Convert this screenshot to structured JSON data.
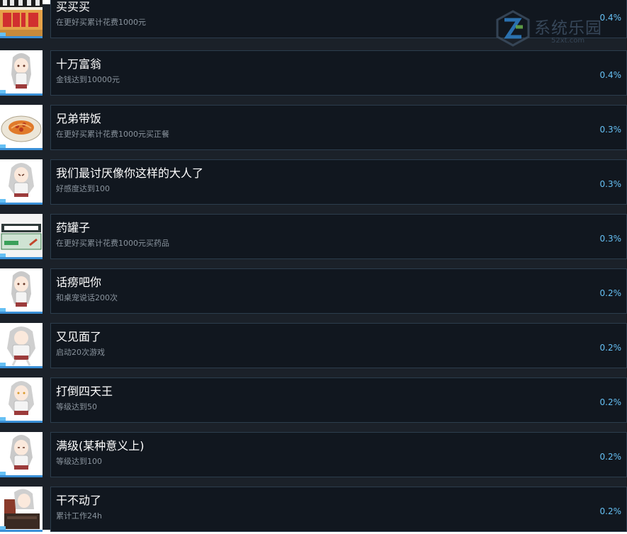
{
  "achievements": [
    {
      "title": "买买买",
      "desc": "在更好买累计花费1000元",
      "pct": "0.4%",
      "icon": "diy-shop-icon"
    },
    {
      "title": "十万富翁",
      "desc": "金钱达到10000元",
      "pct": "0.4%",
      "icon": "anime-girl-icon"
    },
    {
      "title": "兄弟带饭",
      "desc": "在更好买累计花费1000元买正餐",
      "pct": "0.3%",
      "icon": "pasta-plate-icon"
    },
    {
      "title": "我们最讨厌像你这样的大人了",
      "desc": "好感度达到100",
      "pct": "0.3%",
      "icon": "anime-girl-icon"
    },
    {
      "title": "药罐子",
      "desc": "在更好买累计花费1000元买药品",
      "pct": "0.3%",
      "icon": "medicine-sign-icon"
    },
    {
      "title": "话痨吧你",
      "desc": "和桌宠说话200次",
      "pct": "0.2%",
      "icon": "anime-girl-icon"
    },
    {
      "title": "又见面了",
      "desc": "启动20次游戏",
      "pct": "0.2%",
      "icon": "anime-girl-icon"
    },
    {
      "title": "打倒四天王",
      "desc": "等级达到50",
      "pct": "0.2%",
      "icon": "anime-girl-icon"
    },
    {
      "title": "满级(某种意义上)",
      "desc": "等级达到100",
      "pct": "0.2%",
      "icon": "anime-girl-icon"
    },
    {
      "title": "干不动了",
      "desc": "累计工作24h",
      "pct": "0.2%",
      "icon": "anime-girl-desk-icon"
    }
  ],
  "watermark": {
    "name": "系统乐园",
    "url": "52xt.com"
  },
  "colors": {
    "background": "#1b2129",
    "card": "#11171f",
    "percent": "#66c0f4",
    "accent": "#3a8fd6"
  }
}
